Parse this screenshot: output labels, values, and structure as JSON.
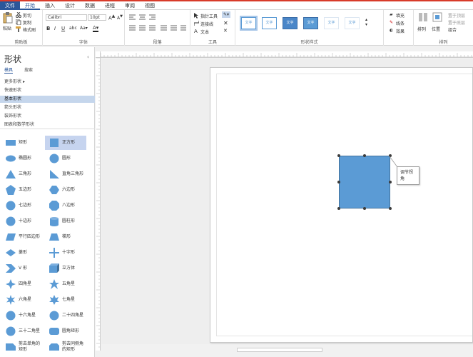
{
  "tabs": [
    "文件",
    "开始",
    "插入",
    "设计",
    "数据",
    "进程",
    "审阅",
    "视图"
  ],
  "ribbon": {
    "clipboard": {
      "paste": "粘贴",
      "cut": "剪切",
      "copy": "复制",
      "format_painter": "格式刷",
      "label": "剪贴板"
    },
    "font": {
      "font_name": "Calibri",
      "font_size": "10pt",
      "label": "字体"
    },
    "paragraph": {
      "label": "段落"
    },
    "tools": {
      "pointer": "指针工具",
      "connector": "连接线",
      "text": "文本",
      "label": "工具"
    },
    "shape_styles": {
      "sample": "文字",
      "fill": "填充",
      "line": "线条",
      "effects": "效果",
      "label": "形状样式"
    },
    "arrange": {
      "arrange": "排列",
      "position": "位置",
      "bring_front": "置于顶层",
      "send_back": "置于底层",
      "group": "组合",
      "label": "排列"
    }
  },
  "pane": {
    "title": "形状",
    "tab_stencils": "模具",
    "tab_search": "搜索",
    "stencils": [
      "更多形状",
      "快速形状",
      "基本形状",
      "箭头形状",
      "装饰形状",
      "图表和数学形状"
    ],
    "shapes": [
      "矩形",
      "正方形",
      "椭圆形",
      "圆形",
      "三角形",
      "直角三角形",
      "五边形",
      "六边形",
      "七边形",
      "八边形",
      "十边形",
      "圆柱形",
      "平行四边形",
      "梯形",
      "菱形",
      "十字形",
      "V 形",
      "立方体",
      "四角星",
      "五角星",
      "六角星",
      "七角星",
      "十六角星",
      "二十四角星",
      "三十二角星",
      "圆角矩形",
      "剪去单角的矩形",
      "剪去同侧角的矩形"
    ]
  },
  "canvas": {
    "tooltip": "调节拐角"
  },
  "colors": {
    "accent": "#2b579a",
    "shape_fill": "#5b9bd5",
    "file_tab": "#2b579a"
  }
}
